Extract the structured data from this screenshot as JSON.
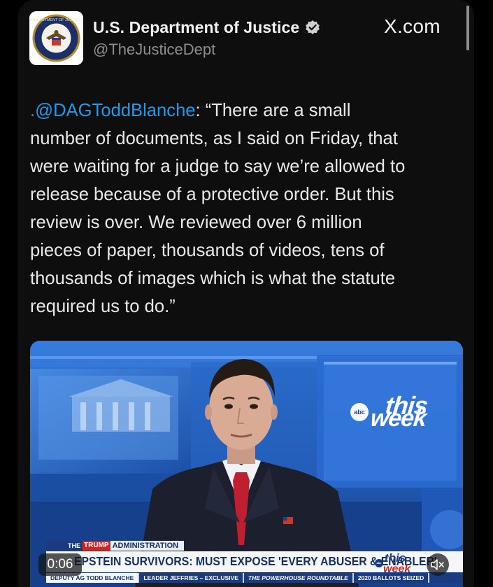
{
  "account": {
    "name": "U.S. Department of Justice",
    "handle": "@TheJusticeDept",
    "verified_icon": "verified-badge-icon",
    "avatar_icon": "doj-seal-icon",
    "seal_text": "DEPARTMENT OF JUSTICE"
  },
  "source": {
    "label": "X.com"
  },
  "tweet": {
    "mention": ".@DAGToddBlanche",
    "lines": [
      ": “There are a small",
      "number of documents, as I said on Friday, that",
      "were waiting for a judge to say we’re allowed to",
      "release because of a protective order. But this",
      "review is over. We reviewed over 6 million",
      "pieces of paper, thousands of videos, tens of",
      "thousands of images which is what the statute",
      "required us to do.”"
    ]
  },
  "video": {
    "show_logo": {
      "abc": "abc",
      "this": "this",
      "week": "week"
    },
    "lower_third": {
      "segment_the": "THE",
      "segment_trump": "TRUMP",
      "segment_admin": "ADMINISTRATION",
      "headline": "EPSTEIN SURVIVORS: MUST EXPOSE 'EVERY ABUSER & ENABLER'",
      "ticker": [
        "DEPUTY AG TODD BLANCHE",
        "LEADER JEFFRIES – EXCLUSIVE",
        "THE POWERHOUSE ROUNDTABLE",
        "2020 BALLOTS SEIZED"
      ]
    },
    "timestamp": "0:06",
    "mute_icon": "speaker-muted-icon"
  },
  "colors": {
    "background": "#000000",
    "card": "#0e0e0f",
    "mention": "#1d9bf0",
    "verified": "#d0d0d0",
    "studio_blue": "#1e57b3",
    "abc_navy": "#1b3b80",
    "abc_red": "#c62828"
  }
}
